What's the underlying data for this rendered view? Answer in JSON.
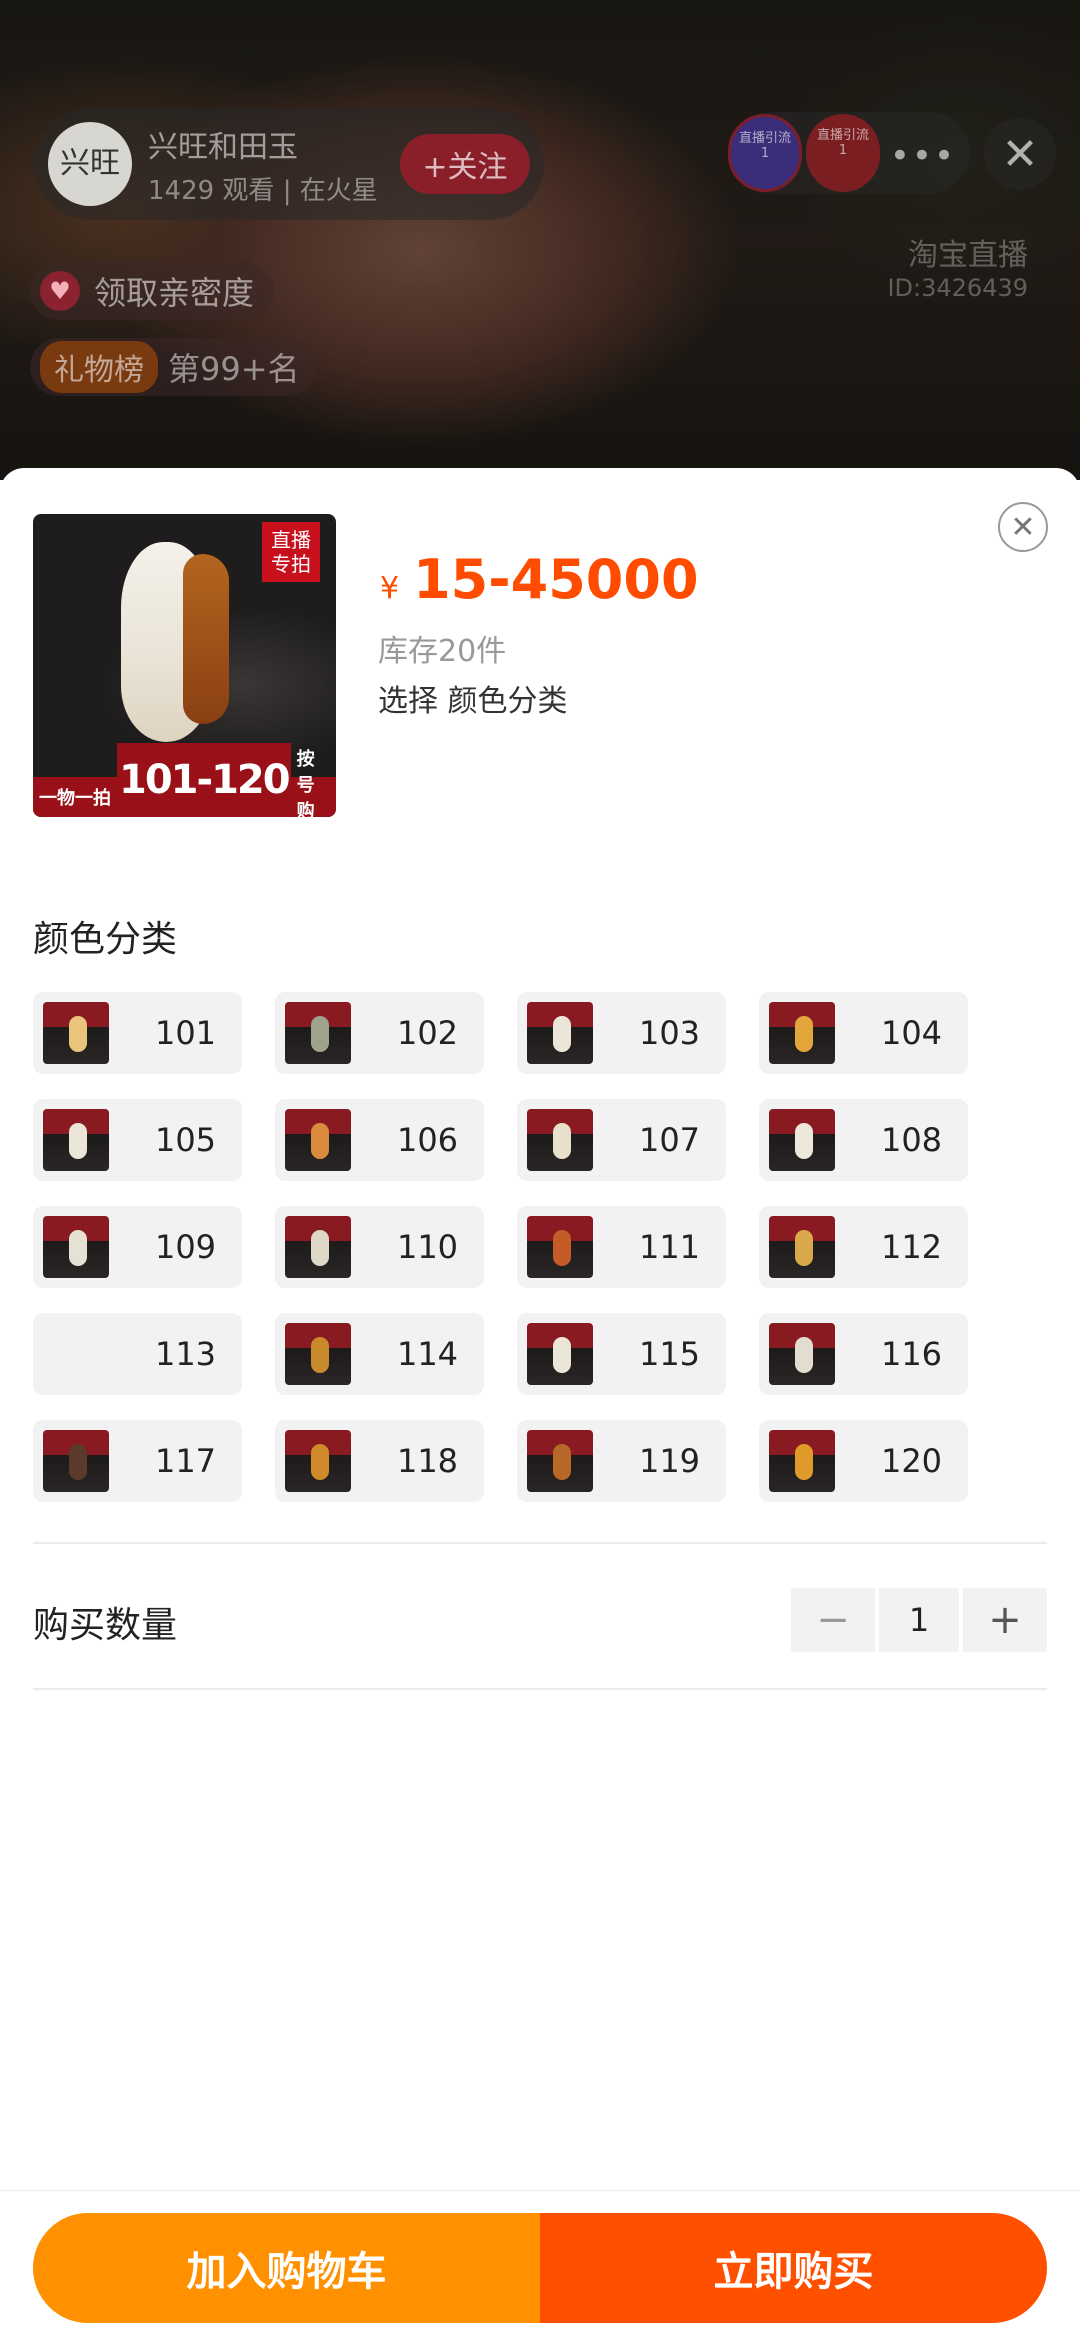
{
  "live": {
    "anchor_avatar_text": "兴旺",
    "anchor_name": "兴旺和田玉",
    "viewer_line": "1429 观看 | 在火星",
    "follow_label": "+关注",
    "badge_1": "直播引流",
    "badge_1_sub": "1",
    "badge_2": "直播引流",
    "badge_2_sub": "1",
    "more_icon": "more-dots-icon",
    "close_icon": "close-icon",
    "platform_label": "淘宝直播",
    "room_id": "ID:3426439",
    "intimacy_label": "领取亲密度",
    "gift_tag": "礼物榜",
    "gift_rank": "第99+名"
  },
  "product": {
    "thumb_banner_left": "一物一拍",
    "thumb_banner_mid": "101-120",
    "thumb_banner_right": "按号购买",
    "stamp_text": "直播专拍",
    "currency": "¥",
    "price": "15-45000",
    "stock": "库存20件",
    "choose": "选择 颜色分类"
  },
  "options_title": "颜色分类",
  "options": [
    {
      "label": "101",
      "stone": "#e9c47a"
    },
    {
      "label": "102",
      "stone": "#9ea48c"
    },
    {
      "label": "103",
      "stone": "#ece6d8"
    },
    {
      "label": "104",
      "stone": "#e2a63a"
    },
    {
      "label": "105",
      "stone": "#ece6d8"
    },
    {
      "label": "106",
      "stone": "#d98a3a"
    },
    {
      "label": "107",
      "stone": "#e7e0cc"
    },
    {
      "label": "108",
      "stone": "#eee8da"
    },
    {
      "label": "109",
      "stone": "#e5e1d4"
    },
    {
      "label": "110",
      "stone": "#ddd8c8"
    },
    {
      "label": "111",
      "stone": "#c55b26"
    },
    {
      "label": "112",
      "stone": "#d9a84a"
    },
    {
      "label": "113",
      "stone": ""
    },
    {
      "label": "114",
      "stone": "#c98a2e"
    },
    {
      "label": "115",
      "stone": "#ece6d8"
    },
    {
      "label": "116",
      "stone": "#e2ddd0"
    },
    {
      "label": "117",
      "stone": "#5a3a2a"
    },
    {
      "label": "118",
      "stone": "#d08a2a"
    },
    {
      "label": "119",
      "stone": "#b8692a"
    },
    {
      "label": "120",
      "stone": "#e09a2a"
    }
  ],
  "quantity": {
    "label": "购买数量",
    "value": "1",
    "minus": "−",
    "plus": "+"
  },
  "actions": {
    "add_to_cart": "加入购物车",
    "buy_now": "立即购买"
  },
  "colors": {
    "price": "#ff4c00",
    "cart_button": "#ff9000",
    "buy_button": "#ff5000"
  }
}
